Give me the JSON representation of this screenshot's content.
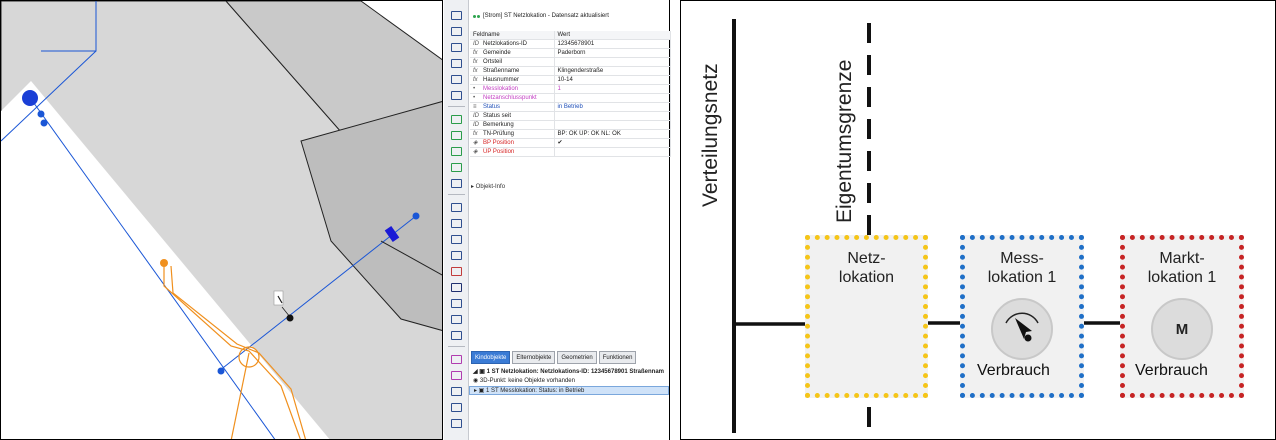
{
  "props": {
    "header": "[Strom] ST Netzlokation  - Datensatz aktualisiert",
    "columns": {
      "name": "Feldname",
      "value": "Wert"
    },
    "rows": [
      {
        "icon": "ID",
        "name": "Netzlokations-ID",
        "value": "12345678901",
        "name_color": "#222",
        "value_color": "#222"
      },
      {
        "icon": "fx",
        "name": "Gemeinde",
        "value": "Paderborn",
        "name_color": "#222",
        "value_color": "#222"
      },
      {
        "icon": "fx",
        "name": "Ortsteil",
        "value": "",
        "name_color": "#222",
        "value_color": "#222"
      },
      {
        "icon": "fx",
        "name": "Straßenname",
        "value": "Klingenderstraße",
        "name_color": "#222",
        "value_color": "#222"
      },
      {
        "icon": "fx",
        "name": "Hausnummer",
        "value": "10-14",
        "name_color": "#222",
        "value_color": "#222"
      },
      {
        "icon": "•",
        "name": "Messlokation",
        "value": "1",
        "name_color": "#c23cc2",
        "value_color": "#c23cc2"
      },
      {
        "icon": "•",
        "name": "Netzanschlusspunkt",
        "value": "",
        "name_color": "#c23cc2",
        "value_color": "#222"
      },
      {
        "icon": "≡",
        "name": "Status",
        "value": "in Betrieb",
        "name_color": "#1f4fb8",
        "value_color": "#1f4fb8"
      },
      {
        "icon": "ID",
        "name": "Status seit",
        "value": "",
        "name_color": "#222",
        "value_color": "#222"
      },
      {
        "icon": "ID",
        "name": "Bemerkung",
        "value": "",
        "name_color": "#222",
        "value_color": "#222"
      },
      {
        "icon": "fx",
        "name": "TN-Prüfung",
        "value": "BP: OK ÜP: OK  NL: OK",
        "name_color": "#222",
        "value_color": "#222"
      },
      {
        "icon": "◈",
        "name": "BP Position",
        "value": "✔",
        "name_color": "#d62424",
        "value_color": "#222"
      },
      {
        "icon": "◈",
        "name": "ÜP Position",
        "value": "",
        "name_color": "#d62424",
        "value_color": "#222"
      }
    ],
    "object_info": "▸ Objekt-Info",
    "tabs": [
      "Kindobjekte",
      "Elternobjekte",
      "Geometrien",
      "Funktionen"
    ],
    "tree": [
      "◢ ▣  1 ST Netzlokation: Netzlokations-ID: 12345678901 Straßennam",
      "      ◉  3D-Punkt: keine Objekte vorhanden",
      "   ▸ ▣  1 ST Messlokation: Status: in Betrieb"
    ]
  },
  "diagram": {
    "verteilungsnetz": "Verteilungsnetz",
    "eigentumsgrenze": "Eigentumsgrenze",
    "boxes": [
      {
        "title": "Netz-\nlokation",
        "border_color": "#f5c518",
        "gauge": "",
        "verbrauch": ""
      },
      {
        "title": "Mess-\nlokation 1",
        "border_color": "#1f6fc7",
        "gauge": "needle",
        "verbrauch": "Verbrauch"
      },
      {
        "title": "Markt-\nlokation 1",
        "border_color": "#c62424",
        "gauge": "M",
        "verbrauch": "Verbrauch"
      }
    ]
  },
  "colors": {
    "blue_line": "#1a56d6",
    "orange_line": "#f0901e",
    "building": "#d7d7d7",
    "building_dark": "#bdbdbd"
  }
}
